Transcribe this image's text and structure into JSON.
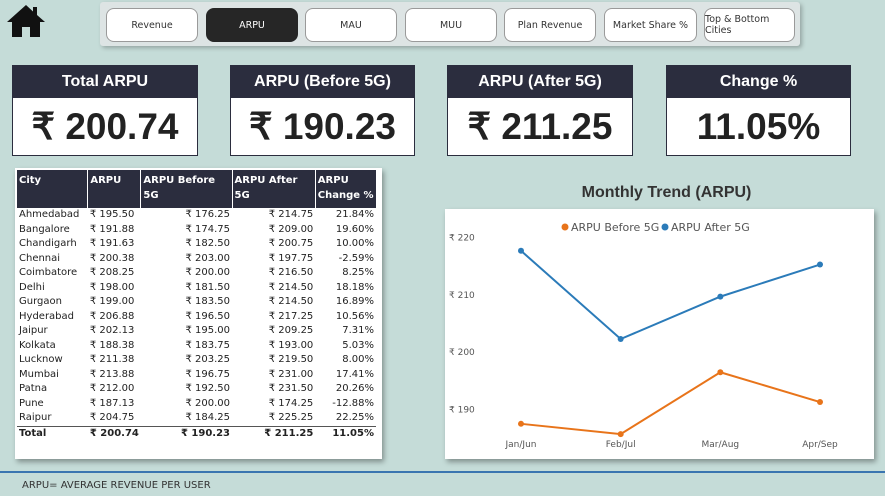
{
  "nav": {
    "buttons": [
      "Revenue",
      "ARPU",
      "MAU",
      "MUU",
      "Plan Revenue",
      "Market Share %",
      "Top & Bottom Cities"
    ],
    "active": "ARPU"
  },
  "kpis": [
    {
      "title": "Total ARPU",
      "value": "₹ 200.74"
    },
    {
      "title": "ARPU (Before 5G)",
      "value": "₹ 190.23"
    },
    {
      "title": "ARPU (After 5G)",
      "value": "₹ 211.25"
    },
    {
      "title": "Change %",
      "value": "11.05%"
    }
  ],
  "table": {
    "headers": [
      "City",
      "ARPU",
      "ARPU Before 5G",
      "ARPU After 5G",
      "ARPU Change %"
    ],
    "rows": [
      [
        "Ahmedabad",
        "₹ 195.50",
        "₹ 176.25",
        "₹ 214.75",
        "21.84%"
      ],
      [
        "Bangalore",
        "₹ 191.88",
        "₹ 174.75",
        "₹ 209.00",
        "19.60%"
      ],
      [
        "Chandigarh",
        "₹ 191.63",
        "₹ 182.50",
        "₹ 200.75",
        "10.00%"
      ],
      [
        "Chennai",
        "₹ 200.38",
        "₹ 203.00",
        "₹ 197.75",
        "-2.59%"
      ],
      [
        "Coimbatore",
        "₹ 208.25",
        "₹ 200.00",
        "₹ 216.50",
        "8.25%"
      ],
      [
        "Delhi",
        "₹ 198.00",
        "₹ 181.50",
        "₹ 214.50",
        "18.18%"
      ],
      [
        "Gurgaon",
        "₹ 199.00",
        "₹ 183.50",
        "₹ 214.50",
        "16.89%"
      ],
      [
        "Hyderabad",
        "₹ 206.88",
        "₹ 196.50",
        "₹ 217.25",
        "10.56%"
      ],
      [
        "Jaipur",
        "₹ 202.13",
        "₹ 195.00",
        "₹ 209.25",
        "7.31%"
      ],
      [
        "Kolkata",
        "₹ 188.38",
        "₹ 183.75",
        "₹ 193.00",
        "5.03%"
      ],
      [
        "Lucknow",
        "₹ 211.38",
        "₹ 203.25",
        "₹ 219.50",
        "8.00%"
      ],
      [
        "Mumbai",
        "₹ 213.88",
        "₹ 196.75",
        "₹ 231.00",
        "17.41%"
      ],
      [
        "Patna",
        "₹ 212.00",
        "₹ 192.50",
        "₹ 231.50",
        "20.26%"
      ],
      [
        "Pune",
        "₹ 187.13",
        "₹ 200.00",
        "₹ 174.25",
        "-12.88%"
      ],
      [
        "Raipur",
        "₹ 204.75",
        "₹ 184.25",
        "₹ 225.25",
        "22.25%"
      ]
    ],
    "total": [
      "Total",
      "₹ 200.74",
      "₹ 190.23",
      "₹ 211.25",
      "11.05%"
    ]
  },
  "chart_data": {
    "type": "line",
    "title": "Monthly Trend (ARPU)",
    "categories": [
      "Jan/Jun",
      "Feb/Jul",
      "Mar/Aug",
      "Apr/Sep"
    ],
    "series": [
      {
        "name": "ARPU  Before 5G",
        "color": "#e8741a",
        "values": [
          187.5,
          185.7,
          196.5,
          191.3
        ]
      },
      {
        "name": "ARPU  After 5G",
        "color": "#2b7bb9",
        "values": [
          217.7,
          202.3,
          209.7,
          215.3
        ]
      }
    ],
    "y_ticks": [
      190,
      200,
      210,
      220
    ],
    "y_tick_labels": [
      "₹ 190",
      "₹ 200",
      "₹ 210",
      "₹ 220"
    ],
    "ylim": [
      184.5,
      221.5
    ],
    "legend_position": "top",
    "grid": false
  },
  "footer": {
    "text": "ARPU= AVERAGE REVENUE PER USER"
  },
  "icons": {
    "home": "home-icon"
  },
  "colors": {
    "header_bg": "#2b2d3e",
    "page_bg": "#c5dcd8",
    "active_tab": "#262626"
  }
}
